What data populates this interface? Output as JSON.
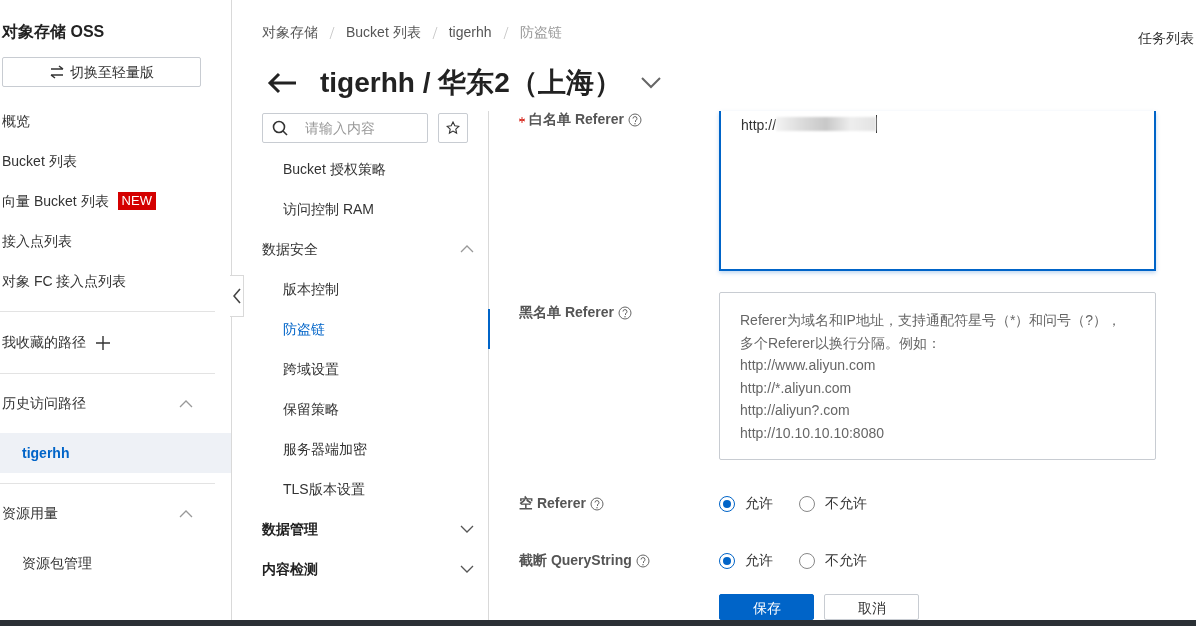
{
  "sidebar": {
    "title": "对象存储 OSS",
    "switch_button": "切换至轻量版",
    "items": [
      {
        "label": "概览"
      },
      {
        "label": "Bucket 列表"
      },
      {
        "label": "向量 Bucket 列表",
        "badge": "NEW"
      },
      {
        "label": "接入点列表"
      },
      {
        "label": "对象 FC 接入点列表"
      }
    ],
    "favorites": {
      "label": "我收藏的路径"
    },
    "sections": [
      {
        "label": "历史访问路径",
        "expanded": true,
        "children": [
          {
            "label": "tigerhh",
            "selected": true
          }
        ]
      },
      {
        "label": "资源用量",
        "expanded": true,
        "children": [
          {
            "label": "资源包管理",
            "selected": false
          }
        ]
      }
    ]
  },
  "breadcrumb": [
    "对象存储",
    "Bucket 列表",
    "tigerhh",
    "防盗链"
  ],
  "task_list": "任务列表",
  "page_title": "tigerhh / 华东2（上海）",
  "menu": {
    "search_placeholder": "请输入内容",
    "items": [
      {
        "kind": "item",
        "label": "Bucket 授权策略",
        "selected": false
      },
      {
        "kind": "item",
        "label": "访问控制 RAM",
        "selected": false
      },
      {
        "kind": "group",
        "label": "数据安全",
        "expanded": true
      },
      {
        "kind": "item",
        "label": "版本控制",
        "selected": false
      },
      {
        "kind": "item",
        "label": "防盗链",
        "selected": true
      },
      {
        "kind": "item",
        "label": "跨域设置",
        "selected": false
      },
      {
        "kind": "item",
        "label": "保留策略",
        "selected": false
      },
      {
        "kind": "item",
        "label": "服务器端加密",
        "selected": false
      },
      {
        "kind": "item",
        "label": "TLS版本设置",
        "selected": false
      },
      {
        "kind": "group",
        "label": "数据管理",
        "expanded": false
      },
      {
        "kind": "group",
        "label": "内容检测",
        "expanded": false
      }
    ]
  },
  "form": {
    "whitelist": {
      "label": "白名单 Referer",
      "required": true,
      "value": "http://",
      "redacted": true
    },
    "blacklist": {
      "label": "黑名单 Referer",
      "placeholder": "Referer为域名和IP地址，支持通配符星号（*）和问号（?），多个Referer以换行分隔。例如：\nhttp://www.aliyun.com\nhttp://*.aliyun.com\nhttp://aliyun?.com\nhttp://10.10.10.10:8080"
    },
    "radios": [
      {
        "label": "空 Referer",
        "options": [
          {
            "label": "允许",
            "selected": true
          },
          {
            "label": "不允许",
            "selected": false
          }
        ]
      },
      {
        "label": "截断 QueryString",
        "options": [
          {
            "label": "允许",
            "selected": true
          },
          {
            "label": "不允许",
            "selected": false
          }
        ]
      }
    ],
    "buttons": [
      {
        "kind": "primary",
        "label": "保存"
      },
      {
        "kind": "secondary",
        "label": "取消"
      }
    ]
  }
}
